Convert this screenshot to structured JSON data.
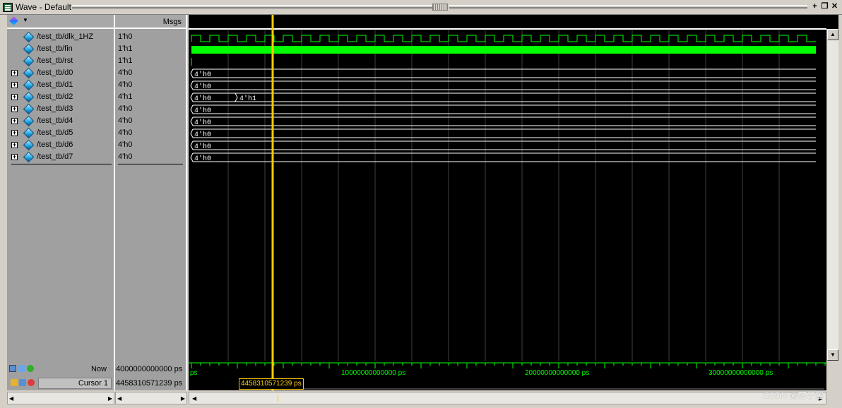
{
  "window": {
    "title": "Wave - Default"
  },
  "header": {
    "msgs_label": "Msgs"
  },
  "signals": [
    {
      "name": "/test_tb/dlk_1HZ",
      "value": "1'h0",
      "expandable": false
    },
    {
      "name": "/test_tb/fin",
      "value": "1'h1",
      "expandable": false
    },
    {
      "name": "/test_tb/rst",
      "value": "1'h1",
      "expandable": false
    },
    {
      "name": "/test_tb/d0",
      "value": "4'h0",
      "expandable": true
    },
    {
      "name": "/test_tb/d1",
      "value": "4'h0",
      "expandable": true
    },
    {
      "name": "/test_tb/d2",
      "value": "4'h1",
      "expandable": true
    },
    {
      "name": "/test_tb/d3",
      "value": "4'h0",
      "expandable": true
    },
    {
      "name": "/test_tb/d4",
      "value": "4'h0",
      "expandable": true
    },
    {
      "name": "/test_tb/d5",
      "value": "4'h0",
      "expandable": true
    },
    {
      "name": "/test_tb/d6",
      "value": "4'h0",
      "expandable": true
    },
    {
      "name": "/test_tb/d7",
      "value": "4'h0",
      "expandable": true
    }
  ],
  "wave_labels": {
    "d0": [
      "4'h0"
    ],
    "d1": [
      "4'h0"
    ],
    "d2": [
      "4'h0",
      "4'h1"
    ],
    "d3": [
      "4'h0"
    ],
    "d4": [
      "4'h0"
    ],
    "d5": [
      "4'h0"
    ],
    "d6": [
      "4'h0"
    ],
    "d7": [
      "4'h0"
    ]
  },
  "status": {
    "now_label": "Now",
    "now_value": "4000000000000 ps",
    "cursor_label": "Cursor 1",
    "cursor_value": "4458310571239 ps",
    "cursor_tag": "4458310571239 ps"
  },
  "timeline": {
    "start_label": "ps",
    "ticks": [
      "10000000000000 ps",
      "20000000000000 ps",
      "30000000000000 ps"
    ]
  },
  "watermark": "CSDN @苏子矍",
  "colors": {
    "wave": "#00ff00",
    "cursor": "#ffcc00",
    "bus": "#ffffff",
    "background": "#000000"
  }
}
